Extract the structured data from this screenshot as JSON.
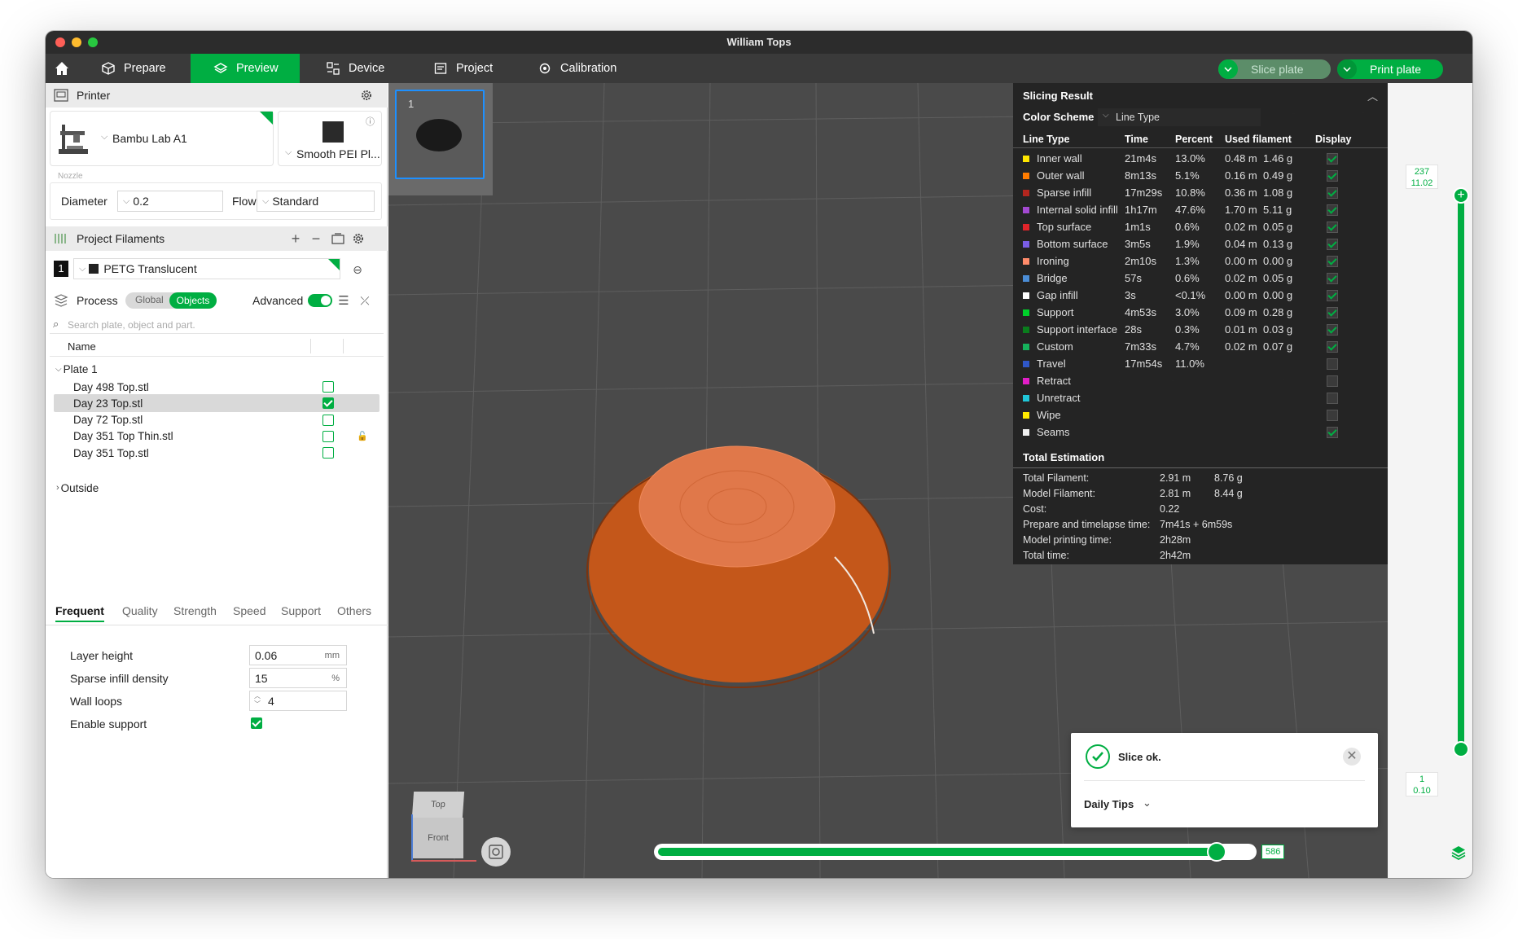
{
  "window": {
    "title": "William Tops"
  },
  "toolbar": {
    "tabs": [
      {
        "label": "Prepare",
        "icon": "cube-icon"
      },
      {
        "label": "Preview",
        "icon": "layers-icon"
      },
      {
        "label": "Device",
        "icon": "device-icon"
      },
      {
        "label": "Project",
        "icon": "project-icon"
      },
      {
        "label": "Calibration",
        "icon": "calibration-icon"
      }
    ],
    "slice_label": "Slice plate",
    "print_label": "Print plate"
  },
  "printer": {
    "section_label": "Printer",
    "name": "Bambu Lab A1",
    "plate": "Smooth PEI Pl...",
    "nozzle_label": "Nozzle",
    "diameter_label": "Diameter",
    "diameter_value": "0.2",
    "flow_label": "Flow",
    "flow_value": "Standard"
  },
  "filaments": {
    "section_label": "Project Filaments",
    "items": [
      {
        "index": "1",
        "name": "PETG Translucent"
      }
    ]
  },
  "process": {
    "section_label": "Process",
    "toggle_global": "Global",
    "toggle_objects": "Objects",
    "advanced_label": "Advanced",
    "search_placeholder": "Search plate, object and part.",
    "tree_header": "Name",
    "plate_label": "Plate 1",
    "objects": [
      {
        "name": "Day 498 Top.stl",
        "checked": false,
        "locked": false
      },
      {
        "name": "Day 23 Top.stl",
        "checked": true,
        "locked": false
      },
      {
        "name": "Day 72 Top.stl",
        "checked": false,
        "locked": false
      },
      {
        "name": "Day 351 Top Thin.stl",
        "checked": false,
        "locked": true
      },
      {
        "name": "Day 351 Top.stl",
        "checked": false,
        "locked": false
      }
    ],
    "outside_label": "Outside",
    "param_tabs": [
      "Frequent",
      "Quality",
      "Strength",
      "Speed",
      "Support",
      "Others"
    ],
    "params": {
      "layer_height_label": "Layer height",
      "layer_height_value": "0.06",
      "layer_height_unit": "mm",
      "infill_label": "Sparse infill density",
      "infill_value": "15",
      "infill_unit": "%",
      "walls_label": "Wall loops",
      "walls_value": "4",
      "support_label": "Enable support",
      "support_enabled": true
    }
  },
  "plate_thumb": {
    "number": "1"
  },
  "slicing": {
    "title": "Slicing Result",
    "scheme_label": "Color Scheme",
    "scheme_value": "Line Type",
    "columns": [
      "Line Type",
      "Time",
      "Percent",
      "Used filament",
      "Display"
    ],
    "rows": [
      {
        "type": "Inner wall",
        "color": "#ffe600",
        "time": "21m4s",
        "pct": "13.0%",
        "m": "0.48 m",
        "g": "1.46 g",
        "on": true
      },
      {
        "type": "Outer wall",
        "color": "#ff7c00",
        "time": "8m13s",
        "pct": "5.1%",
        "m": "0.16 m",
        "g": "0.49 g",
        "on": true
      },
      {
        "type": "Sparse infill",
        "color": "#b3261e",
        "time": "17m29s",
        "pct": "10.8%",
        "m": "0.36 m",
        "g": "1.08 g",
        "on": true
      },
      {
        "type": "Internal solid infill",
        "color": "#a349d1",
        "time": "1h17m",
        "pct": "47.6%",
        "m": "1.70 m",
        "g": "5.11 g",
        "on": true
      },
      {
        "type": "Top surface",
        "color": "#e0242a",
        "time": "1m1s",
        "pct": "0.6%",
        "m": "0.02 m",
        "g": "0.05 g",
        "on": true
      },
      {
        "type": "Bottom surface",
        "color": "#7a5ee6",
        "time": "3m5s",
        "pct": "1.9%",
        "m": "0.04 m",
        "g": "0.13 g",
        "on": true
      },
      {
        "type": "Ironing",
        "color": "#ff8b6a",
        "time": "2m10s",
        "pct": "1.3%",
        "m": "0.00 m",
        "g": "0.00 g",
        "on": true
      },
      {
        "type": "Bridge",
        "color": "#4b8dd6",
        "time": "57s",
        "pct": "0.6%",
        "m": "0.02 m",
        "g": "0.05 g",
        "on": true
      },
      {
        "type": "Gap infill",
        "color": "#ffffff",
        "time": "3s",
        "pct": "<0.1%",
        "m": "0.00 m",
        "g": "0.00 g",
        "on": true
      },
      {
        "type": "Support",
        "color": "#00d02a",
        "time": "4m53s",
        "pct": "3.0%",
        "m": "0.09 m",
        "g": "0.28 g",
        "on": true
      },
      {
        "type": "Support interface",
        "color": "#0a7d1d",
        "time": "28s",
        "pct": "0.3%",
        "m": "0.01 m",
        "g": "0.03 g",
        "on": true
      },
      {
        "type": "Custom",
        "color": "#16b25c",
        "time": "7m33s",
        "pct": "4.7%",
        "m": "0.02 m",
        "g": "0.07 g",
        "on": true
      },
      {
        "type": "Travel",
        "color": "#2f57c8",
        "time": "17m54s",
        "pct": "11.0%",
        "m": "",
        "g": "",
        "on": false
      },
      {
        "type": "Retract",
        "color": "#e21ec8",
        "time": "",
        "pct": "",
        "m": "",
        "g": "",
        "on": false
      },
      {
        "type": "Unretract",
        "color": "#20c6d8",
        "time": "",
        "pct": "",
        "m": "",
        "g": "",
        "on": false
      },
      {
        "type": "Wipe",
        "color": "#ffea00",
        "time": "",
        "pct": "",
        "m": "",
        "g": "",
        "on": false
      },
      {
        "type": "Seams",
        "color": "#f0f0f0",
        "time": "",
        "pct": "",
        "m": "",
        "g": "",
        "on": true
      }
    ],
    "total_title": "Total Estimation",
    "totals": [
      {
        "label": "Total Filament:",
        "v1": "2.91 m",
        "v2": "8.76 g"
      },
      {
        "label": "Model Filament:",
        "v1": "2.81 m",
        "v2": "8.44 g"
      },
      {
        "label": "Cost:",
        "v1": "0.22",
        "v2": ""
      },
      {
        "label": "Prepare and timelapse time:",
        "v1": "7m41s + 6m59s",
        "v2": ""
      },
      {
        "label": "Model printing time:",
        "v1": "2h28m",
        "v2": ""
      },
      {
        "label": "Total time:",
        "v1": "2h42m",
        "v2": ""
      }
    ]
  },
  "layer_slider": {
    "top_layer": "237",
    "top_height": "11.02",
    "bottom_layer": "1",
    "bottom_height": "0.10"
  },
  "move_slider": {
    "value": "586",
    "progress": 0.94
  },
  "view_cube": {
    "top": "Top",
    "front": "Front"
  },
  "toast": {
    "message": "Slice ok.",
    "tips": "Daily Tips"
  },
  "colors": {
    "accent": "#00ae42",
    "toolbar": "#3a3a3a",
    "viewport": "#4a4a4a",
    "model": "#d2651c"
  }
}
